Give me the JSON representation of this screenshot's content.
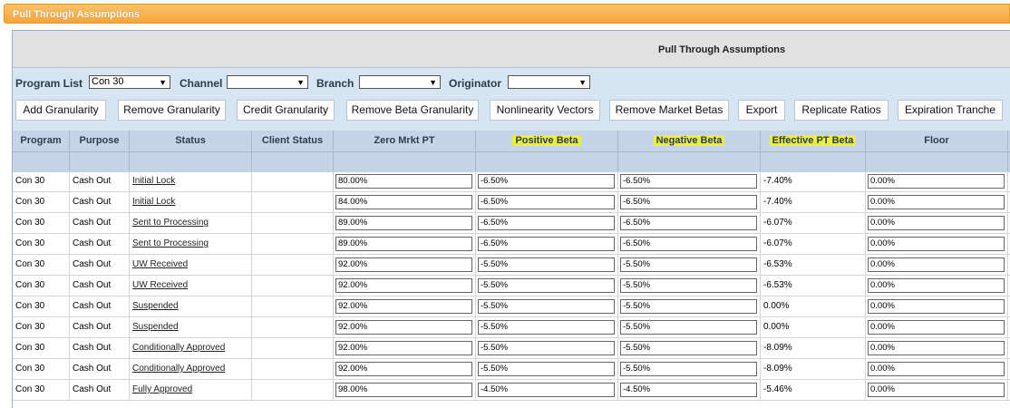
{
  "top_bar_title": "Pull Through Assumptions",
  "panel_title": "Pull Through Assumptions",
  "filters": {
    "program_list_label": "Program List",
    "program_list_value": "Con 30",
    "channel_label": "Channel",
    "channel_value": "",
    "branch_label": "Branch",
    "branch_value": "",
    "originator_label": "Originator",
    "originator_value": ""
  },
  "buttons": [
    "Add Granularity",
    "Remove Granularity",
    "Credit Granularity",
    "Remove Beta Granularity",
    "Nonlinearity Vectors",
    "Remove Market Betas",
    "Export",
    "Replicate Ratios",
    "Expiration Tranche"
  ],
  "columns": [
    "Program",
    "Purpose",
    "Status",
    "Client Status",
    "Zero Mrkt PT",
    "Positive Beta",
    "Negative Beta",
    "Effective PT Beta",
    "Floor"
  ],
  "highlight_color": "#e8f23b",
  "rows": [
    {
      "program": "Con 30",
      "purpose": "Cash Out",
      "status": "Initial Lock",
      "client_status": "",
      "zero": "80.00%",
      "pos": "-6.50%",
      "neg": "-6.50%",
      "eff": "-7.40%",
      "floor": "0.00%"
    },
    {
      "program": "Con 30",
      "purpose": "Cash Out",
      "status": "Initial Lock",
      "client_status": "",
      "zero": "84.00%",
      "pos": "-6.50%",
      "neg": "-6.50%",
      "eff": "-7.40%",
      "floor": "0.00%"
    },
    {
      "program": "Con 30",
      "purpose": "Cash Out",
      "status": "Sent to Processing",
      "client_status": "",
      "zero": "89.00%",
      "pos": "-6.50%",
      "neg": "-6.50%",
      "eff": "-6.07%",
      "floor": "0.00%"
    },
    {
      "program": "Con 30",
      "purpose": "Cash Out",
      "status": "Sent to Processing",
      "client_status": "",
      "zero": "89.00%",
      "pos": "-6.50%",
      "neg": "-6.50%",
      "eff": "-6.07%",
      "floor": "0.00%"
    },
    {
      "program": "Con 30",
      "purpose": "Cash Out",
      "status": "UW Received",
      "client_status": "",
      "zero": "92.00%",
      "pos": "-5.50%",
      "neg": "-5.50%",
      "eff": "-6.53%",
      "floor": "0.00%"
    },
    {
      "program": "Con 30",
      "purpose": "Cash Out",
      "status": "UW Received",
      "client_status": "",
      "zero": "92.00%",
      "pos": "-5.50%",
      "neg": "-5.50%",
      "eff": "-6.53%",
      "floor": "0.00%"
    },
    {
      "program": "Con 30",
      "purpose": "Cash Out",
      "status": "Suspended",
      "client_status": "",
      "zero": "92.00%",
      "pos": "-5.50%",
      "neg": "-5.50%",
      "eff": "0.00%",
      "floor": "0.00%"
    },
    {
      "program": "Con 30",
      "purpose": "Cash Out",
      "status": "Suspended",
      "client_status": "",
      "zero": "92.00%",
      "pos": "-5.50%",
      "neg": "-5.50%",
      "eff": "0.00%",
      "floor": "0.00%"
    },
    {
      "program": "Con 30",
      "purpose": "Cash Out",
      "status": "Conditionally Approved",
      "client_status": "",
      "zero": "92.00%",
      "pos": "-5.50%",
      "neg": "-5.50%",
      "eff": "-8.09%",
      "floor": "0.00%"
    },
    {
      "program": "Con 30",
      "purpose": "Cash Out",
      "status": "Conditionally Approved",
      "client_status": "",
      "zero": "92.00%",
      "pos": "-5.50%",
      "neg": "-5.50%",
      "eff": "-8.09%",
      "floor": "0.00%"
    },
    {
      "program": "Con 30",
      "purpose": "Cash Out",
      "status": "Fully Approved",
      "client_status": "",
      "zero": "98.00%",
      "pos": "-4.50%",
      "neg": "-4.50%",
      "eff": "-5.46%",
      "floor": "0.00%"
    }
  ]
}
